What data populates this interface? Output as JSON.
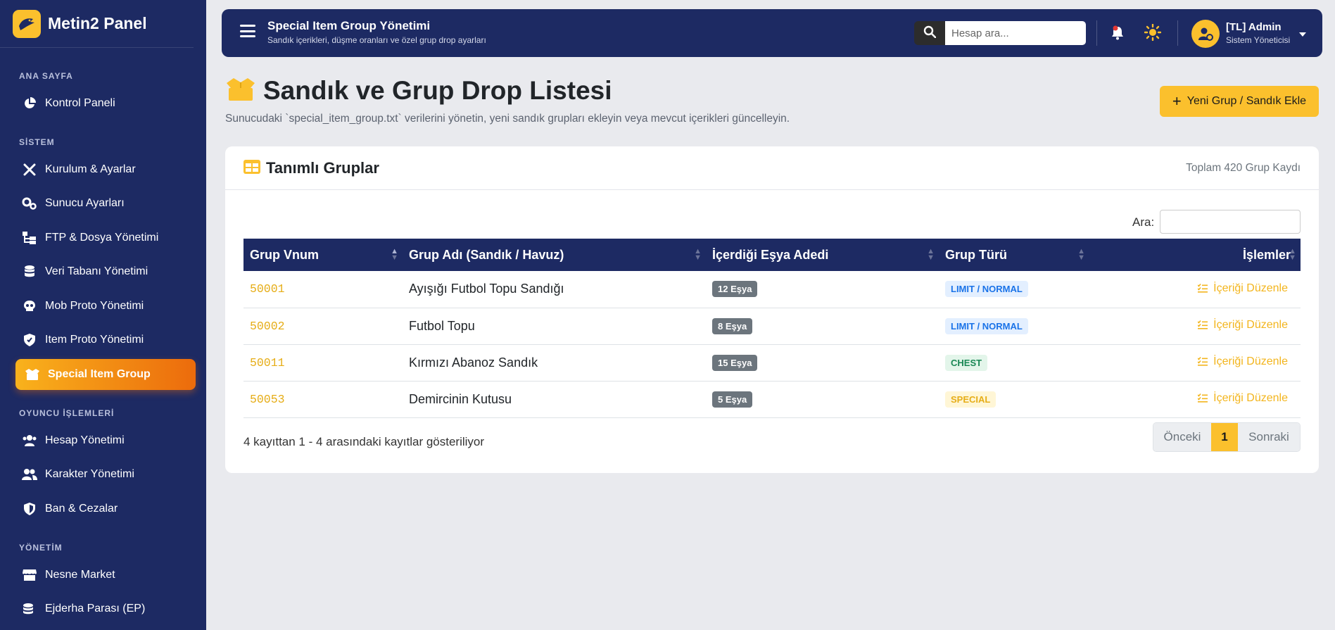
{
  "brand": {
    "name": "Metin2 Panel"
  },
  "sidebar": {
    "sections": [
      "ANA SAYFA",
      "SİSTEM",
      "OYUNCU İŞLEMLERİ",
      "YÖNETİM"
    ],
    "items": [
      {
        "label": "Kontrol Paneli",
        "icon": "chart-pie-icon"
      },
      {
        "label": "Kurulum & Ayarlar",
        "icon": "tools-icon"
      },
      {
        "label": "Sunucu Ayarları",
        "icon": "gears-icon"
      },
      {
        "label": "FTP & Dosya Yönetimi",
        "icon": "folder-tree-icon"
      },
      {
        "label": "Veri Tabanı Yönetimi",
        "icon": "database-icon"
      },
      {
        "label": "Mob Proto Yönetimi",
        "icon": "skull-icon"
      },
      {
        "label": "Item Proto Yönetimi",
        "icon": "shield-icon"
      },
      {
        "label": "Special Item Group",
        "icon": "box-open-icon"
      },
      {
        "label": "Hesap Yönetimi",
        "icon": "users-icon"
      },
      {
        "label": "Karakter Yönetimi",
        "icon": "user-friends-icon"
      },
      {
        "label": "Ban & Cezalar",
        "icon": "shield-half-icon"
      },
      {
        "label": "Nesne Market",
        "icon": "store-icon"
      },
      {
        "label": "Ejderha Parası (EP)",
        "icon": "coins-icon"
      }
    ],
    "active_color": "#f9b21c"
  },
  "topbar": {
    "title": "Special Item Group Yönetimi",
    "subtitle": "Sandık içerikleri, düşme oranları ve özel grup drop ayarları",
    "search_placeholder": "Hesap ara...",
    "user_name": "[TL] Admin",
    "user_role": "Sistem Yöneticisi"
  },
  "page": {
    "title": "Sandık ve Grup Drop Listesi",
    "description": "Sunucudaki `special_item_group.txt` verilerini yönetin, yeni sandık grupları ekleyin veya mevcut içerikleri güncelleyin.",
    "add_button": "Yeni Grup / Sandık Ekle"
  },
  "card": {
    "title": "Tanımlı Gruplar",
    "count_text": "Toplam 420 Grup Kaydı",
    "filter_label": "Ara:"
  },
  "table": {
    "headers": [
      "Grup Vnum",
      "Grup Adı (Sandık / Havuz)",
      "İçerdiği Eşya Adedi",
      "Grup Türü",
      "İşlemler"
    ],
    "rows": [
      {
        "vnum": "50001",
        "name": "Ayışığı Futbol Topu Sandığı",
        "count": "12 Eşya",
        "type": "LIMIT / NORMAL",
        "action": "İçeriği Düzenle"
      },
      {
        "vnum": "50002",
        "name": "Futbol Topu",
        "count": "8 Eşya",
        "type": "LIMIT / NORMAL",
        "action": "İçeriği Düzenle"
      },
      {
        "vnum": "50011",
        "name": "Kırmızı Abanoz Sandık",
        "count": "15 Eşya",
        "type": "CHEST",
        "action": "İçeriği Düzenle"
      },
      {
        "vnum": "50053",
        "name": "Demircinin Kutusu",
        "count": "5 Eşya",
        "type": "SPECIAL",
        "action": "İçeriği Düzenle"
      }
    ]
  },
  "footer": {
    "info": "4 kayıttan 1 - 4 arasındaki kayıtlar gösteriliyor",
    "prev": "Önceki",
    "current": "1",
    "next": "Sonraki"
  },
  "colors": {
    "navy": "#1d2a63",
    "accent": "#fbc02d"
  }
}
